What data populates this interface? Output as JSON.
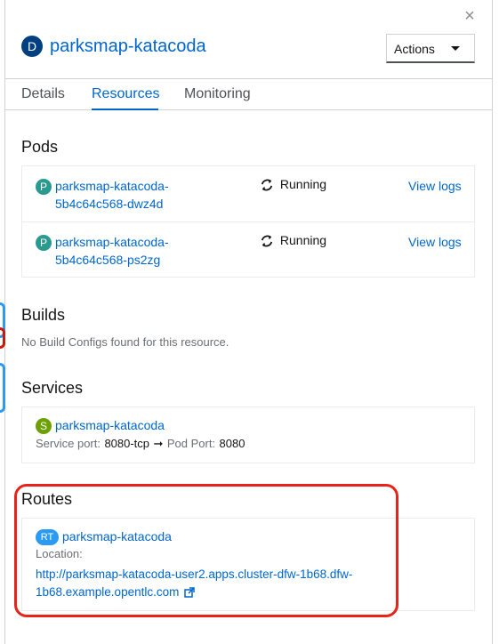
{
  "header": {
    "badge": "D",
    "title": "parksmap-katacoda",
    "actions_label": "Actions",
    "close_glyph": "×"
  },
  "tabs": [
    {
      "label": "Details",
      "active": false
    },
    {
      "label": "Resources",
      "active": true
    },
    {
      "label": "Monitoring",
      "active": false
    }
  ],
  "pods": {
    "title": "Pods",
    "items": [
      {
        "badge": "P",
        "name_line1": "parksmap-katacoda-",
        "name_line2": "5b4c64c568-dwz4d",
        "status": "Running",
        "link": "View logs"
      },
      {
        "badge": "P",
        "name_line1": "parksmap-katacoda-",
        "name_line2": "5b4c64c568-ps2zg",
        "status": "Running",
        "link": "View logs"
      }
    ]
  },
  "builds": {
    "title": "Builds",
    "empty_text": "No Build Configs found for this resource."
  },
  "services": {
    "title": "Services",
    "item": {
      "badge": "S",
      "name": "parksmap-katacoda",
      "service_port_label": "Service port:",
      "service_port": "8080-tcp",
      "arrow": "➞",
      "pod_port_label": "Pod Port:",
      "pod_port": "8080"
    }
  },
  "routes": {
    "title": "Routes",
    "item": {
      "badge": "RT",
      "name": "parksmap-katacoda",
      "location_label": "Location:",
      "url_line1": "http://parksmap-katacoda-user2.apps.cluster-dfw-1b68.dfw-",
      "url_line2": "1b68.example.opentlc.com"
    }
  },
  "colors": {
    "link": "#0066cc",
    "highlight": "#e8231a"
  }
}
